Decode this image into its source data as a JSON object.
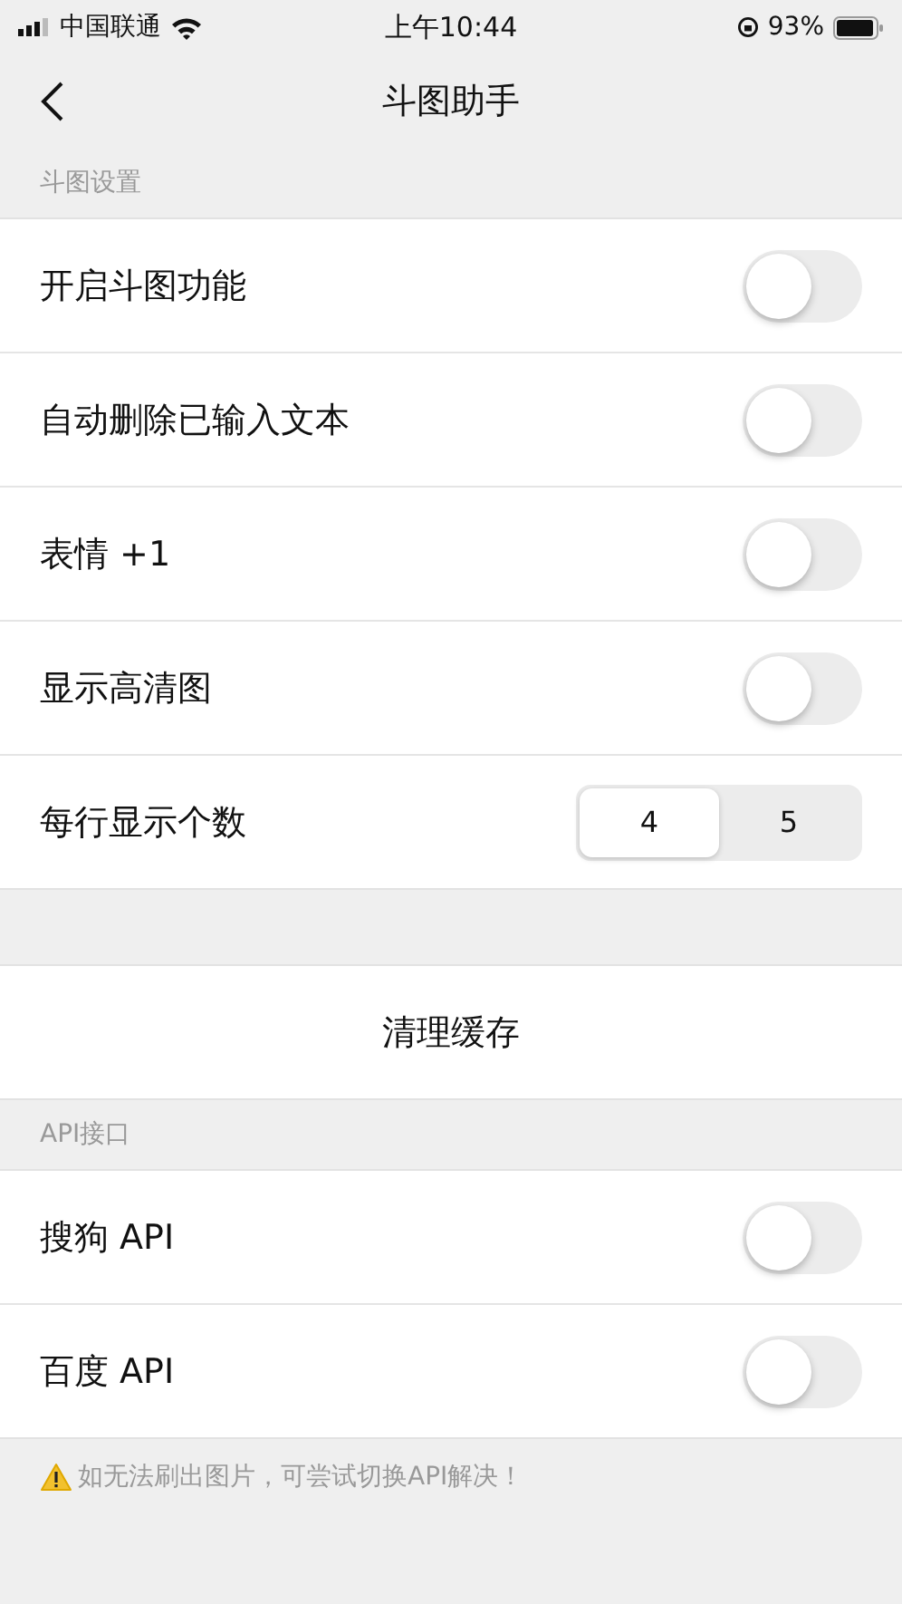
{
  "status_bar": {
    "carrier": "中国联通",
    "time": "上午10:44",
    "battery": "93%"
  },
  "nav": {
    "title": "斗图助手"
  },
  "sections": [
    {
      "header": "斗图设置",
      "rows": [
        {
          "kind": "toggle",
          "label": "开启斗图功能",
          "on": false
        },
        {
          "kind": "toggle",
          "label": "自动删除已输入文本",
          "on": false
        },
        {
          "kind": "toggle",
          "label": "表情 +1",
          "on": false
        },
        {
          "kind": "toggle",
          "label": "显示高清图",
          "on": false
        },
        {
          "kind": "segmented",
          "label": "每行显示个数",
          "options": [
            {
              "label": "4",
              "selected": true
            },
            {
              "label": "5",
              "selected": false
            }
          ]
        }
      ]
    },
    {
      "rows": [
        {
          "kind": "action",
          "label": "清理缓存"
        }
      ]
    },
    {
      "header": "API接口",
      "rows": [
        {
          "kind": "toggle",
          "label": "搜狗 API",
          "on": false
        },
        {
          "kind": "toggle",
          "label": "百度 API",
          "on": false
        }
      ]
    }
  ],
  "footer_note": "如无法刷出图片，可尝试切换API解决！"
}
